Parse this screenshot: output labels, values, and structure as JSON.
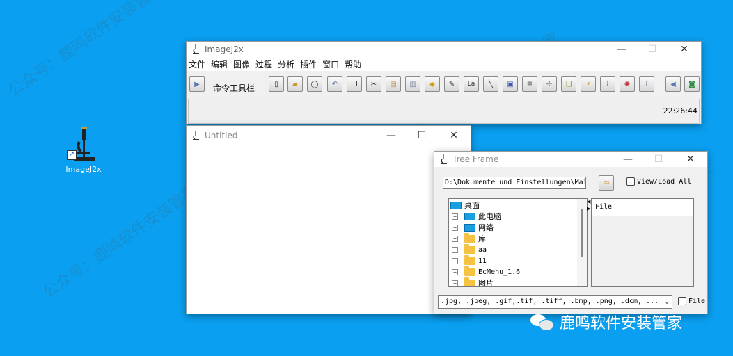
{
  "desktop": {
    "icon_label": "ImageJ2x"
  },
  "main_window": {
    "title": "ImageJ2x",
    "menu": [
      "文件",
      "编辑",
      "图像",
      "过程",
      "分析",
      "插件",
      "窗口",
      "帮助"
    ],
    "toolbar_label": "命令工具栏",
    "clock": "22:26:44"
  },
  "untitled_window": {
    "title": "Untitled"
  },
  "tree_frame": {
    "title": "Tree Frame",
    "path": "D:\\Dokumente und Einstellungen\\Mal",
    "view_load_all": "View/Load All",
    "tree": [
      {
        "label": "桌面",
        "kind": "monitor",
        "root": true
      },
      {
        "label": "此电脑",
        "kind": "monitor"
      },
      {
        "label": "网络",
        "kind": "monitor"
      },
      {
        "label": "库",
        "kind": "folder"
      },
      {
        "label": "aa",
        "kind": "folder"
      },
      {
        "label": "11",
        "kind": "folder"
      },
      {
        "label": "EcMenu_1.6",
        "kind": "folder"
      },
      {
        "label": "图片",
        "kind": "folder"
      }
    ],
    "file_list_header": "File",
    "filter": ".jpg, .jpeg, .gif,.tif, .tiff, .bmp, .png, .dcm, ...",
    "file_checkbox": "File"
  },
  "watermark": {
    "text": "公众号：鹿鸣软件安装管家",
    "brand": "鹿鸣软件安装管家"
  }
}
